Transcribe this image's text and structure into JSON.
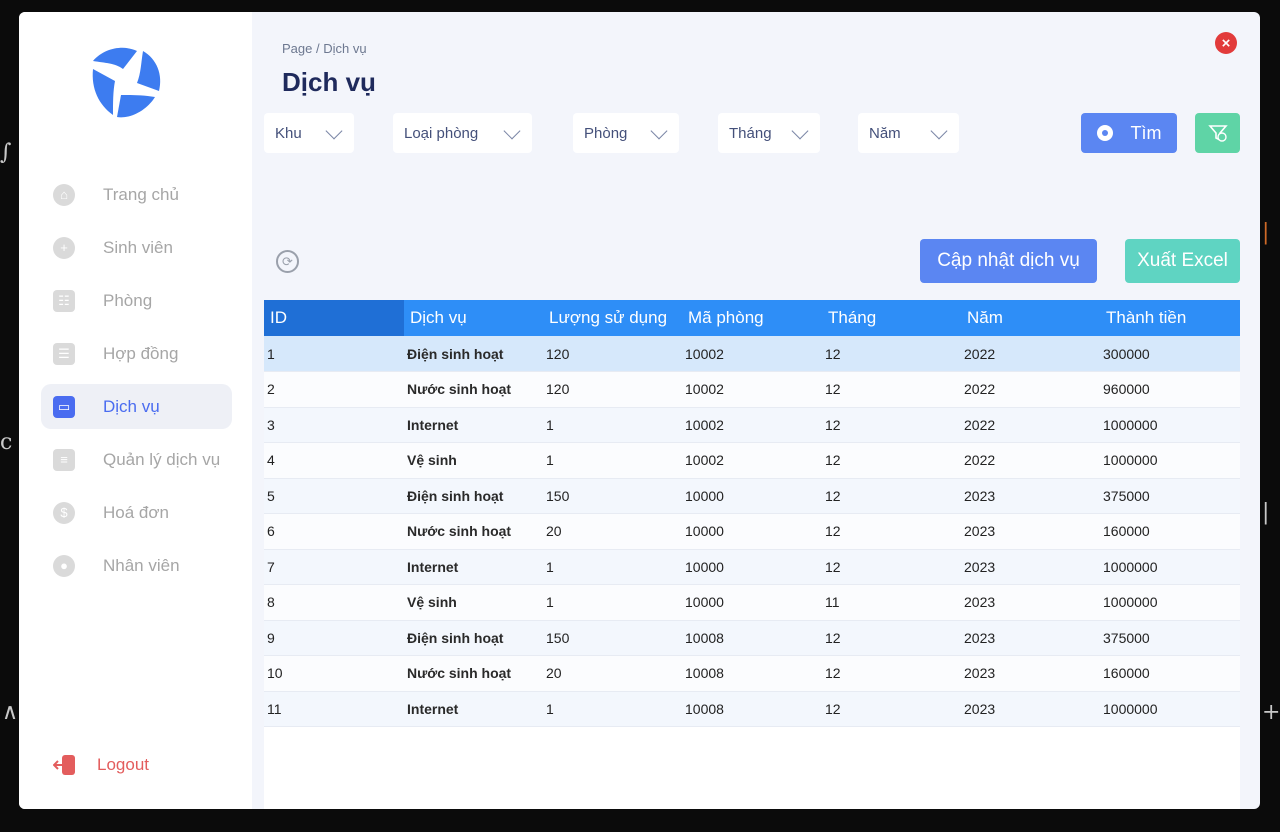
{
  "sidebar": {
    "items": [
      {
        "label": "Trang chủ"
      },
      {
        "label": "Sinh viên"
      },
      {
        "label": "Phòng"
      },
      {
        "label": "Hợp đồng"
      },
      {
        "label": "Dịch vụ"
      },
      {
        "label": "Quản lý dịch vụ"
      },
      {
        "label": "Hoá đơn"
      },
      {
        "label": "Nhân viên"
      }
    ],
    "active_index": 4,
    "logout_label": "Logout"
  },
  "header": {
    "breadcrumb": "Page / Dịch vụ",
    "title": "Dịch vụ"
  },
  "filters": {
    "khu": "Khu",
    "loai_phong": "Loại phòng",
    "phong": "Phòng",
    "thang": "Tháng",
    "nam": "Năm",
    "search_label": "Tìm"
  },
  "actions": {
    "update_label": "Cập nhật dịch vụ",
    "export_label": "Xuất Excel"
  },
  "table": {
    "columns": [
      "ID",
      "Dịch vụ",
      "Lượng sử dụng",
      "Mã phòng",
      "Tháng",
      "Năm",
      "Thành tiền"
    ],
    "rows": [
      [
        "1",
        "Điện sinh hoạt",
        "120",
        "10002",
        "12",
        "2022",
        "300000"
      ],
      [
        "2",
        "Nước sinh hoạt",
        "120",
        "10002",
        "12",
        "2022",
        "960000"
      ],
      [
        "3",
        "Internet",
        "1",
        "10002",
        "12",
        "2022",
        "1000000"
      ],
      [
        "4",
        "Vệ sinh",
        "1",
        "10002",
        "12",
        "2022",
        "1000000"
      ],
      [
        "5",
        "Điện sinh hoạt",
        "150",
        "10000",
        "12",
        "2023",
        "375000"
      ],
      [
        "6",
        "Nước sinh hoạt",
        "20",
        "10000",
        "12",
        "2023",
        "160000"
      ],
      [
        "7",
        "Internet",
        "1",
        "10000",
        "12",
        "2023",
        "1000000"
      ],
      [
        "8",
        "Vệ sinh",
        "1",
        "10000",
        "11",
        "2023",
        "1000000"
      ],
      [
        "9",
        "Điện sinh hoạt",
        "150",
        "10008",
        "12",
        "2023",
        "375000"
      ],
      [
        "10",
        "Nước sinh hoạt",
        "20",
        "10008",
        "12",
        "2023",
        "160000"
      ],
      [
        "11",
        "Internet",
        "1",
        "10008",
        "12",
        "2023",
        "1000000"
      ]
    ],
    "selected_row": 0
  },
  "colors": {
    "accent": "#4a6cf0",
    "header": "#2e8ef7",
    "excel": "#5fd4c2",
    "danger": "#e23b3b"
  }
}
